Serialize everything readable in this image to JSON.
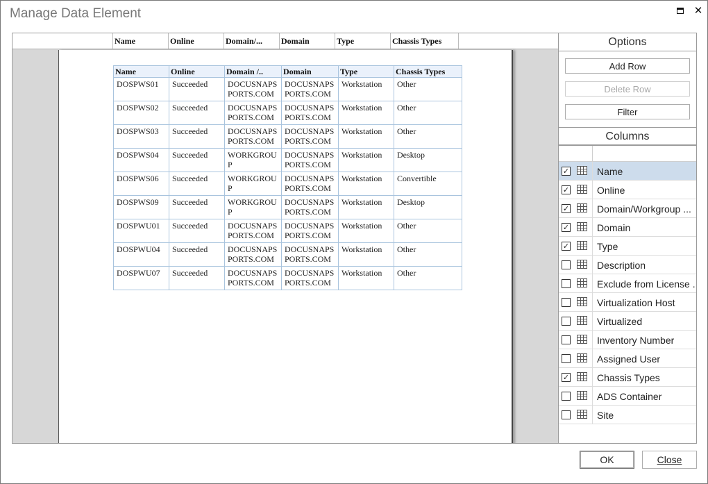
{
  "window": {
    "title": "Manage Data Element"
  },
  "preview": {
    "header_columns": [
      "Name",
      "Online",
      "Domain/...",
      "Domain",
      "Type",
      "Chassis Types"
    ],
    "table_headers": [
      "Name",
      "Online",
      "Domain /..",
      "Domain",
      "Type",
      "Chassis Types"
    ],
    "rows": [
      [
        "DOSPWS01",
        "Succeeded",
        "DOCUSNAPSPORTS.COM",
        "DOCUSNAPSPORTS.COM",
        "Workstation",
        "Other"
      ],
      [
        "DOSPWS02",
        "Succeeded",
        "DOCUSNAPSPORTS.COM",
        "DOCUSNAPSPORTS.COM",
        "Workstation",
        "Other"
      ],
      [
        "DOSPWS03",
        "Succeeded",
        "DOCUSNAPSPORTS.COM",
        "DOCUSNAPSPORTS.COM",
        "Workstation",
        "Other"
      ],
      [
        "DOSPWS04",
        "Succeeded",
        "WORKGROUP",
        "DOCUSNAPSPORTS.COM",
        "Workstation",
        "Desktop"
      ],
      [
        "DOSPWS06",
        "Succeeded",
        "WORKGROUP",
        "DOCUSNAPSPORTS.COM",
        "Workstation",
        "Convertible"
      ],
      [
        "DOSPWS09",
        "Succeeded",
        "WORKGROUP",
        "DOCUSNAPSPORTS.COM",
        "Workstation",
        "Desktop"
      ],
      [
        "DOSPWU01",
        "Succeeded",
        "DOCUSNAPSPORTS.COM",
        "DOCUSNAPSPORTS.COM",
        "Workstation",
        "Other"
      ],
      [
        "DOSPWU04",
        "Succeeded",
        "DOCUSNAPSPORTS.COM",
        "DOCUSNAPSPORTS.COM",
        "Workstation",
        "Other"
      ],
      [
        "DOSPWU07",
        "Succeeded",
        "DOCUSNAPSPORTS.COM",
        "DOCUSNAPSPORTS.COM",
        "Workstation",
        "Other"
      ]
    ]
  },
  "options": {
    "title": "Options",
    "add_row": "Add Row",
    "delete_row": "Delete Row",
    "filter": "Filter"
  },
  "columns": {
    "title": "Columns",
    "items": [
      {
        "label": "Name",
        "checked": true,
        "selected": true
      },
      {
        "label": "Online",
        "checked": true,
        "selected": false
      },
      {
        "label": "Domain/Workgroup ...",
        "checked": true,
        "selected": false
      },
      {
        "label": "Domain",
        "checked": true,
        "selected": false
      },
      {
        "label": "Type",
        "checked": true,
        "selected": false
      },
      {
        "label": "Description",
        "checked": false,
        "selected": false
      },
      {
        "label": "Exclude from License ...",
        "checked": false,
        "selected": false
      },
      {
        "label": "Virtualization Host",
        "checked": false,
        "selected": false
      },
      {
        "label": "Virtualized",
        "checked": false,
        "selected": false
      },
      {
        "label": "Inventory Number",
        "checked": false,
        "selected": false
      },
      {
        "label": "Assigned User",
        "checked": false,
        "selected": false
      },
      {
        "label": "Chassis Types",
        "checked": true,
        "selected": false
      },
      {
        "label": "ADS Container",
        "checked": false,
        "selected": false
      },
      {
        "label": "Site",
        "checked": false,
        "selected": false
      }
    ]
  },
  "footer": {
    "ok": "OK",
    "close": "Close"
  }
}
